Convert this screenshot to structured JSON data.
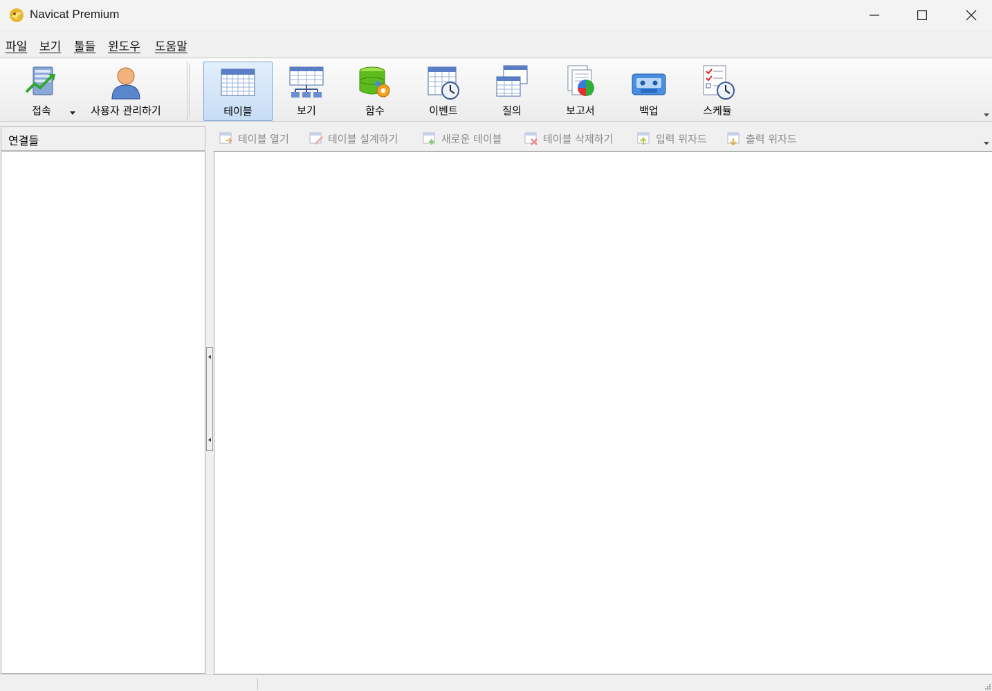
{
  "window": {
    "title": "Navicat Premium"
  },
  "menu": [
    "파일",
    "보기",
    "툴들",
    "윈도우",
    "도움말"
  ],
  "toolbar": {
    "connect": "접속",
    "user_manage": "사용자 관리하기",
    "table": "테이블",
    "view": "보기",
    "function": "함수",
    "event": "이벤트",
    "query": "질의",
    "report": "보고서",
    "backup": "백업",
    "schedule": "스케듈"
  },
  "left_panel": {
    "header": "연결들"
  },
  "sub_toolbar": {
    "open_table": "테이블 열기",
    "design_table": "테이블 설계하기",
    "new_table": "새로운 테이블",
    "delete_table": "테이블 삭제하기",
    "import_wizard": "입력 위자드",
    "export_wizard": "출력 위자드"
  },
  "colors": {
    "accent_active": "#c7ddf6",
    "active_border": "#7da2ce",
    "disabled_text": "#8a8a8a"
  }
}
